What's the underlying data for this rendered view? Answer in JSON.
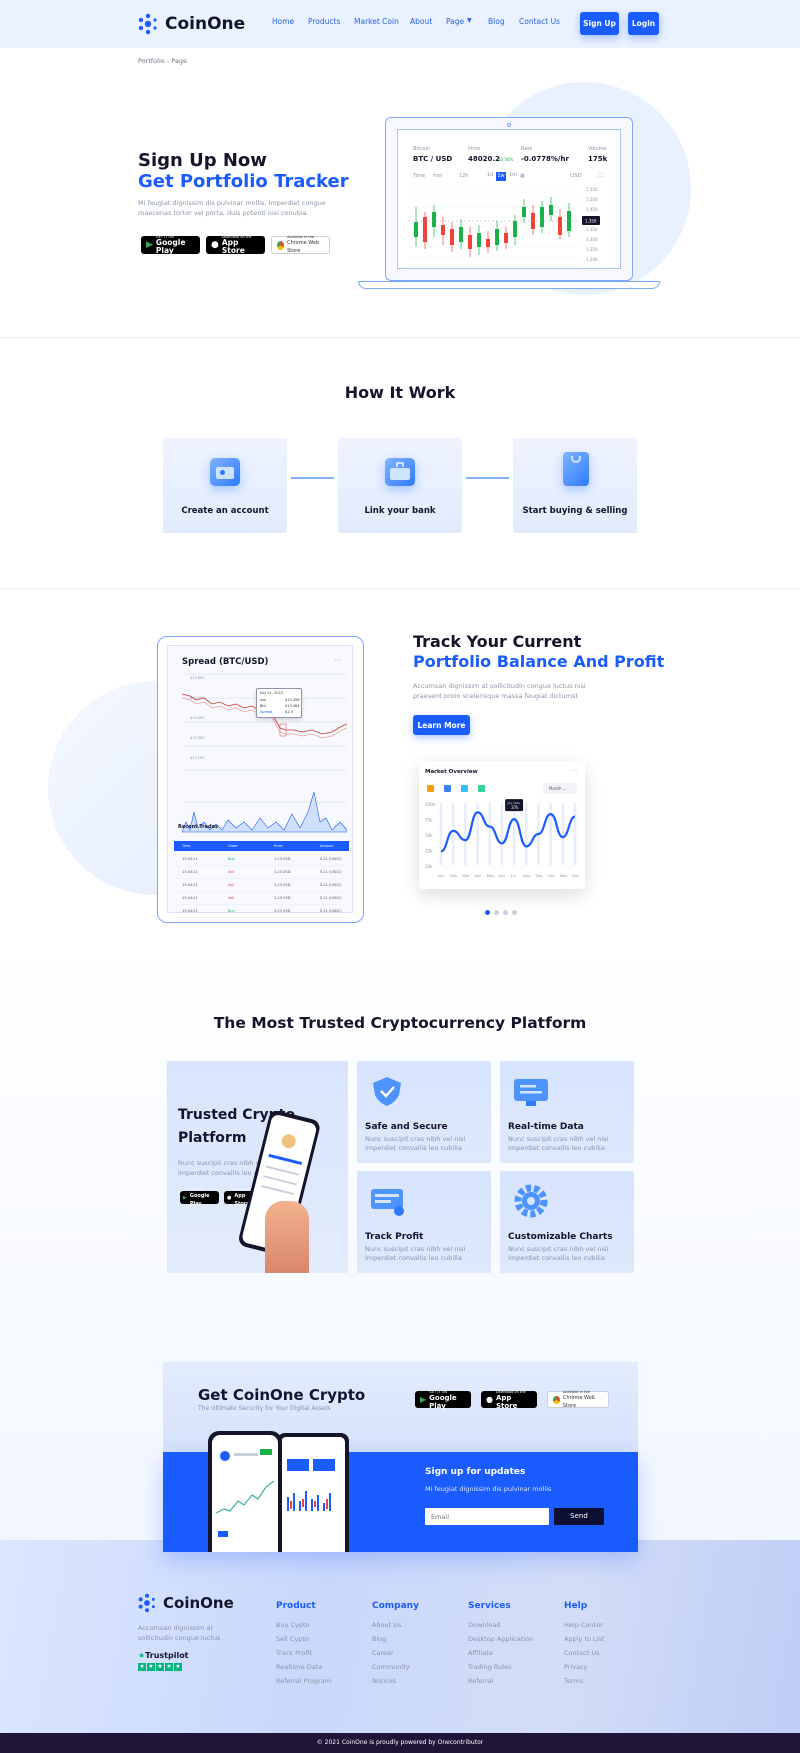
{
  "brand": {
    "name": "CoinOne"
  },
  "nav": {
    "items": [
      "Home",
      "Products",
      "Market Coin",
      "About",
      "Page",
      "Blog",
      "Contact Us"
    ],
    "signup": "Sign Up",
    "login": "Login"
  },
  "breadcrumb": "Portfolio - Page",
  "hero": {
    "title1": "Sign Up Now",
    "title2": "Get Portfolio Tracker",
    "text1": "Mi feugiat dignissim dis pulvinar mollis, imperdiet congue",
    "text2": "maecenas tortor vel porta, duis potenti nisi conubia.",
    "ticker": {
      "pair_label": "Bitcoin",
      "pair": "BTC / USD",
      "price_label": "Price",
      "price": "48020.2",
      "price_change": "40.56%",
      "rate_label": "Rate",
      "rate": "-0.0778%/hr",
      "volume_label": "Volume",
      "volume": "175k",
      "time_label": "Time",
      "min": "min",
      "hours": "12h",
      "ranges": [
        "1d",
        "1w",
        "1m"
      ],
      "currency": "USD",
      "axis": [
        "1,550",
        "1,500",
        "1,450",
        "1,400",
        "1,350",
        "1,300",
        "1,250",
        "1,200"
      ],
      "current": "1,350"
    }
  },
  "stores": {
    "gp_small": "GET IT ON",
    "gp_big": "Google Play",
    "as_small": "Download on the",
    "as_big": "App Store",
    "cw_small": "Available in the",
    "cw_big": "Chrome Web Store"
  },
  "how": {
    "title": "How It Work",
    "steps": [
      "Create an account",
      "Link your bank",
      "Start buying & selling"
    ]
  },
  "track": {
    "title1": "Track Your Current",
    "title2": "Portfolio Balance And Profit",
    "text1": "Accumsan dignissim at sollicitudin congue luctus nisi",
    "text2": "praesent proin scelerisque massa feugiat dictumst",
    "button": "Learn More",
    "spread_title": "Spread (BTC/USD)",
    "spread_axis": [
      "$13,600",
      "$13,500",
      "$13,400",
      "$13,300",
      "$13,200"
    ],
    "tooltip": {
      "date": "July 21, 2022",
      "l1": "Ask",
      "v1": "$13,496",
      "l2": "Bid",
      "v2": "$13,484",
      "l3": "Spread",
      "v3": "$1.3"
    },
    "recent_trades": "Recent Trades",
    "trade_headers": [
      "Time",
      "Order",
      "Price",
      "Amount"
    ],
    "trades": [
      {
        "time": "13:44:21",
        "order": "Buy",
        "price": "1.23 USD",
        "amount": "0.21 (USDC)"
      },
      {
        "time": "13:44:21",
        "order": "Sell",
        "price": "1.23 USD",
        "amount": "0.21 (USDC)"
      },
      {
        "time": "13:44:21",
        "order": "Sell",
        "price": "1.23 USD",
        "amount": "0.21 (USDC)"
      },
      {
        "time": "13:44:21",
        "order": "Sell",
        "price": "1.23 USD",
        "amount": "0.21 (USDC)"
      },
      {
        "time": "13:44:21",
        "order": "Buy",
        "price": "1.23 USD",
        "amount": "0.21 (USDC)"
      }
    ],
    "market": {
      "title": "Market Overview",
      "period": "Month",
      "yaxis": [
        "100k",
        "75k",
        "50k",
        "25k",
        "10k"
      ],
      "months": [
        "Jan",
        "Feb",
        "Mar",
        "Apr",
        "May",
        "Jun",
        "Jul",
        "Aug",
        "Sep",
        "Oct",
        "Nov",
        "Dec"
      ],
      "tooltip_label": "July 2022",
      "tooltip_value": "37k",
      "values": [
        22,
        55,
        40,
        85,
        62,
        35,
        74,
        30,
        50,
        82,
        45,
        78
      ]
    }
  },
  "trusted": {
    "title": "The Most Trusted Cryptocurrency Platform",
    "big_title1": "Trusted Crypto",
    "big_title2": "Platform",
    "big_text1": "Nunc suscipit cras nibh vel nisi",
    "big_text2": "imperdiet convallis leo cubilia",
    "features": [
      {
        "title": "Safe and Secure",
        "t1": "Nunc suscipit cras nibh vel nisi",
        "t2": "imperdiet convallis leo cubilia"
      },
      {
        "title": "Real-time Data",
        "t1": "Nunc suscipit cras nibh vel nisi",
        "t2": "imperdiet convallis leo cubilia"
      },
      {
        "title": "Track Profit",
        "t1": "Nunc suscipit cras nibh vel nisi",
        "t2": "imperdiet convallis leo cubilia"
      },
      {
        "title": "Customizable Charts",
        "t1": "Nunc suscipit cras nibh vel nisi",
        "t2": "imperdiet convallis leo cubilia"
      }
    ]
  },
  "cta": {
    "title": "Get CoinOne Crypto",
    "subtitle": "The Ultimate Security for Your Digital Assets",
    "signup_title": "Sign up for updates",
    "signup_text": "Mi feugiat dignissim dis pulvinar mollis",
    "email_placeholder": "Email",
    "send": "Send"
  },
  "footer": {
    "about1": "Accumsan dignissim at",
    "about2": "sollicitudin congue luctus",
    "trustpilot": "Trustpilot",
    "columns": [
      {
        "title": "Product",
        "links": [
          "Buy Cypto",
          "Sell Cypto",
          "Track Profit",
          "Realtime Data",
          "Referral Program"
        ]
      },
      {
        "title": "Company",
        "links": [
          "About Us",
          "Blog",
          "Career",
          "Community",
          "Notices"
        ]
      },
      {
        "title": "Services",
        "links": [
          "Download",
          "Desktop Application",
          "Affiliate",
          "Trading Rules",
          "Referral"
        ]
      },
      {
        "title": "Help",
        "links": [
          "Help Center",
          "Apply to List",
          "Contact Us",
          "Privacy",
          "Terms"
        ]
      }
    ],
    "copyright": "© 2021 CoinOne is proudly powered by Onecontributor"
  },
  "colors": {
    "primary": "#1a5cff",
    "dark": "#14142b",
    "candle_up": "#19b24a",
    "candle_down": "#f0443b",
    "footer_bar": "#1e1538"
  },
  "icons": [
    "coinone-logo-icon",
    "chevron-down-icon",
    "id-card-icon",
    "briefcase-icon",
    "shopping-bag-icon",
    "shield-icon",
    "monitor-icon",
    "card-stack-icon",
    "gear-icon",
    "star-icon",
    "google-play-icon",
    "apple-icon",
    "chrome-icon"
  ]
}
